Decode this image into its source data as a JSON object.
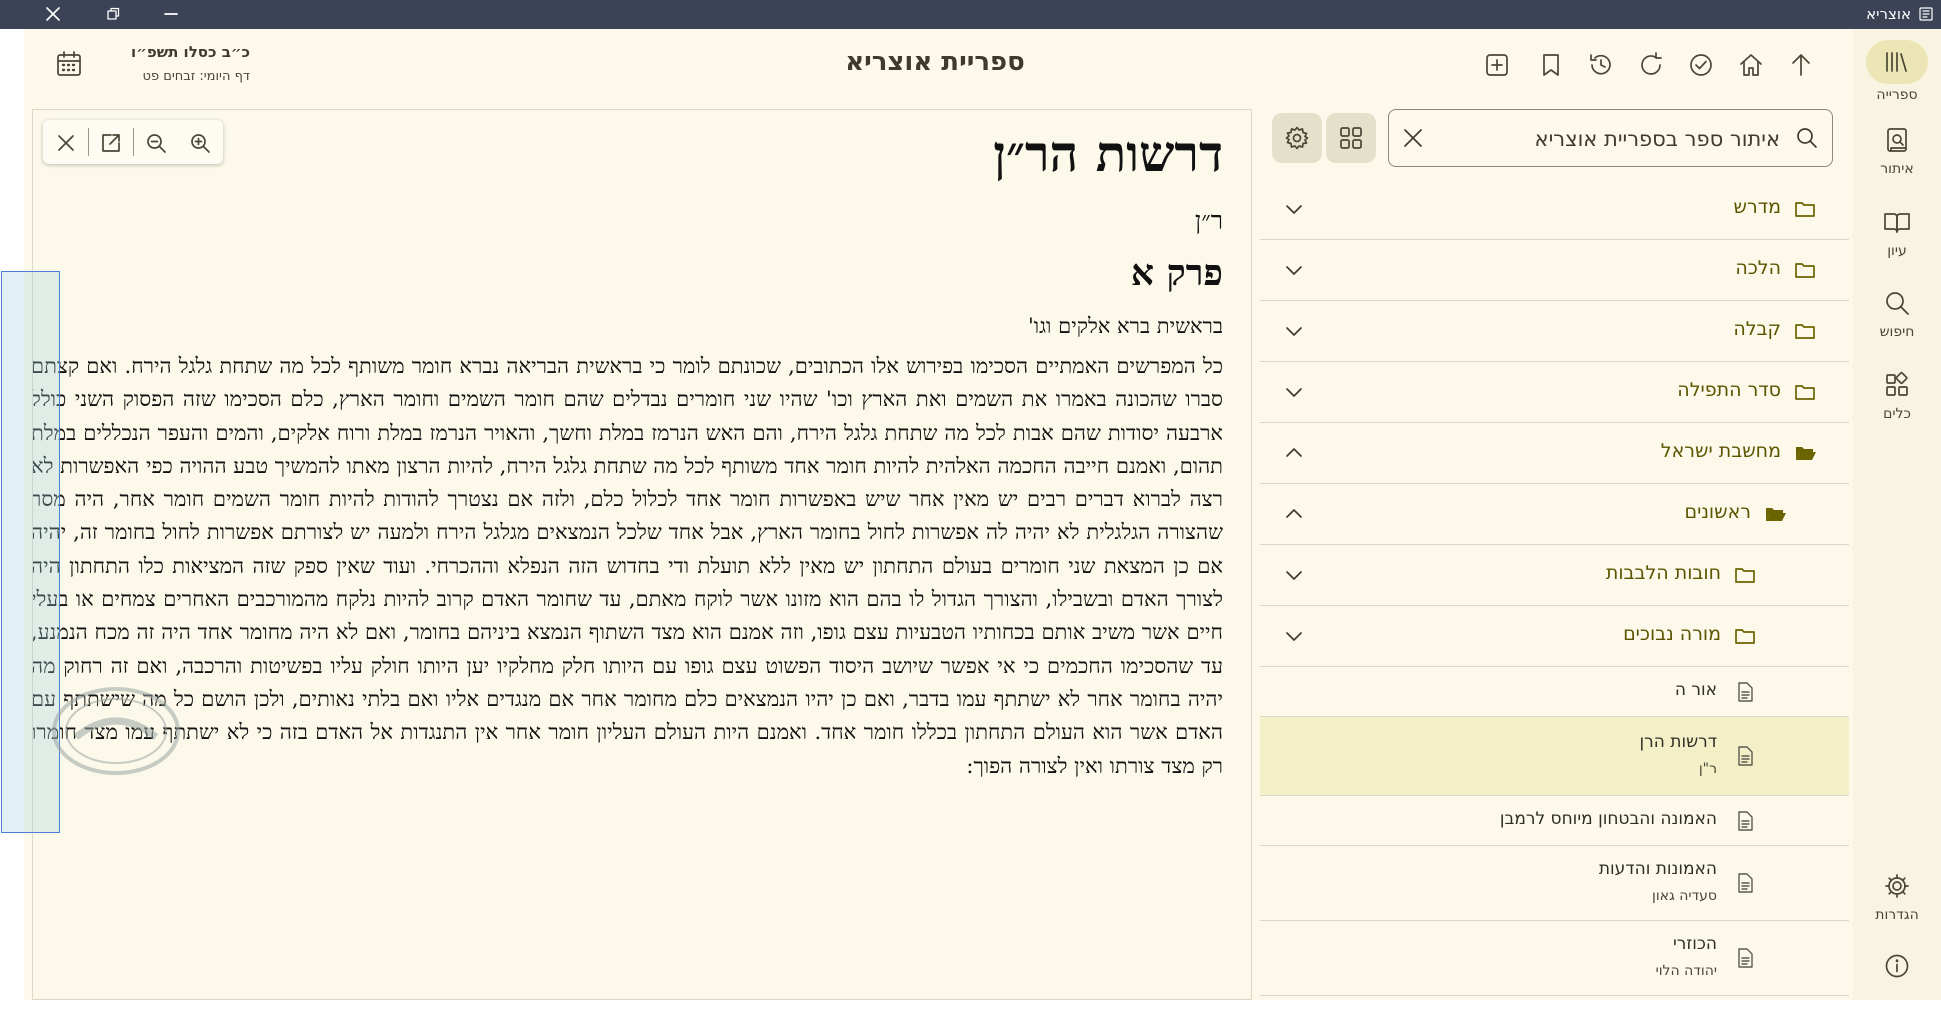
{
  "window": {
    "title": "אוצריא",
    "controls": {
      "close": "close-icon",
      "restore": "restore-icon",
      "minimize": "minimize-icon"
    }
  },
  "header": {
    "title": "ספריית אוצריא",
    "hebrew_date": "כ״ב כסלו תשפ״ו",
    "daf_yomi": "דף היומי: זבחים פט",
    "toolbar_icons": [
      "up-arrow-icon",
      "home-icon",
      "check-circle-icon",
      "refresh-icon",
      "history-icon",
      "bookmark-icon",
      "add-tab-icon"
    ]
  },
  "rail": {
    "items": [
      {
        "label": "ספרייה",
        "icon": "library-icon",
        "active": true
      },
      {
        "label": "איתור",
        "icon": "find-book-icon"
      },
      {
        "label": "עיון",
        "icon": "open-book-icon"
      },
      {
        "label": "חיפוש",
        "icon": "search-icon"
      },
      {
        "label": "כלים",
        "icon": "tools-icon"
      }
    ],
    "settings_label": "הגדרות"
  },
  "library": {
    "search_placeholder": "איתור ספר בספריית אוצריא",
    "items": [
      {
        "label": "מדרש",
        "type": "category",
        "expanded": false
      },
      {
        "label": "הלכה",
        "type": "category",
        "expanded": false
      },
      {
        "label": "קבלה",
        "type": "category",
        "expanded": false
      },
      {
        "label": "סדר התפילה",
        "type": "category",
        "expanded": false
      },
      {
        "label": "מחשבת ישראל",
        "type": "category",
        "expanded": true
      },
      {
        "label": "ראשונים",
        "type": "category",
        "expanded": true
      },
      {
        "label": "חובות הלבבות",
        "type": "category",
        "expanded": false
      },
      {
        "label": "מורה נבוכים",
        "type": "category",
        "expanded": false
      },
      {
        "label": "אור ה",
        "type": "book"
      },
      {
        "label": "דרשות הרן",
        "sub": "ר\"ן",
        "type": "book",
        "selected": true
      },
      {
        "label": "האמונה והבטחון מיוחס לרמבן",
        "type": "book"
      },
      {
        "label": "האמונות והדעות",
        "sub": "סעדיה גאון",
        "type": "book"
      },
      {
        "label": "הכוזרי",
        "sub": "יהודה הלוי",
        "type": "book"
      }
    ]
  },
  "reader": {
    "tools": [
      "close-icon",
      "open-external-icon",
      "zoom-out-icon",
      "zoom-in-icon"
    ],
    "title": "דרשות הר״ן",
    "author": "ר״ן",
    "chapter": "פרק א",
    "verse": "בראשית ברא אלקים וגו'",
    "paragraph": "כל המפרשים האמתיים הסכימו בפירוש אלו הכתובים, שכונתם לומר כי בראשית הבריאה נברא חומר משותף לכל מה שתחת גלגל הירח. ואם קצתם סברו שהכונה באמרו את השמים ואת הארץ וכו' שהיו שני חומרים נבדלים שהם חומר השמים וחומר הארץ, כלם הסכימו שזה הפסוק השני כולל ארבעה יסודות שהם אבות לכל מה שתחת גלגל הירח, והם האש הנרמז במלת וחשך, והאויר הנרמז במלת ורוח אלקים, והמים והעפר הנכללים במלת תהום, ואמנם חייבה החכמה האלהית להיות חומר אחד משותף לכל מה שתחת גלגל הירח, להיות הרצון מאתו להמשיך טבע ההויה כפי האפשרות לא רצה לברוא דברים רבים יש מאין אחר שיש באפשרות חומר אחד לכלול כלם, ולזה אם נצטרך להודות להיות חומר השמים חומר אחר, היה מסר שהצורה הגלגלית לא יהיה לה אפשרות לחול בחומר הארץ, אבל אחד שלכל הנמצאים מגלגל הירח ולמעה יש לצורתם אפשרות לחול בחומר זה, יהיה אם כן המצאת שני חומרים בעולם התחתון יש מאין ללא תועלת ודי בחדוש הזה הנפלא וההכרחי. ועוד שאין ספק שזה המציאות כלו התחתון היה לצורך האדם ובשבילו, והצורך הגדול לו בהם הוא מזונו אשר לוקח מאתם, עד שחומר האדם קרוב להיות נלקח מהמורכבים האחרים צמחים או בעלי חיים אשר משיב אותם בכחותיו הטבעיות עצם גופו, וזה אמנם הוא מצד השתוף הנמצא ביניהם בחומר, ואם לא היה מחומר אחד היה זה מכח הנמנע, עד שהסכימו החכמים כי אי אפשר שיושב היסוד הפשוט עצם גופו עם היותו חלק מחלקיו יען היותו חולק עליו בפשיטות והרכבה, ואם זה רחוק מה יהיה בחומר אחר לא ישתתף עמו בדבר, ואם כן יהיו הנמצאים כלם מחומר אחר אם מנגדים אליו ואם בלתי נאותים, ולכן הושם כל מה שישתתף עם האדם אשר הוא העולם התחתון בכללו חומר אחד. ואמנם היות העולם העליון חומר אחר אין התנגדות אל האדם בזה כי לא ישתתף עמו מצד חומרו רק מצד צורתו ואין לצורה הפוך:"
  },
  "colors": {
    "titlebar": "#3c4356",
    "background": "#fcf9ea",
    "accent": "#6b6400",
    "selected": "#f3f0c8"
  }
}
